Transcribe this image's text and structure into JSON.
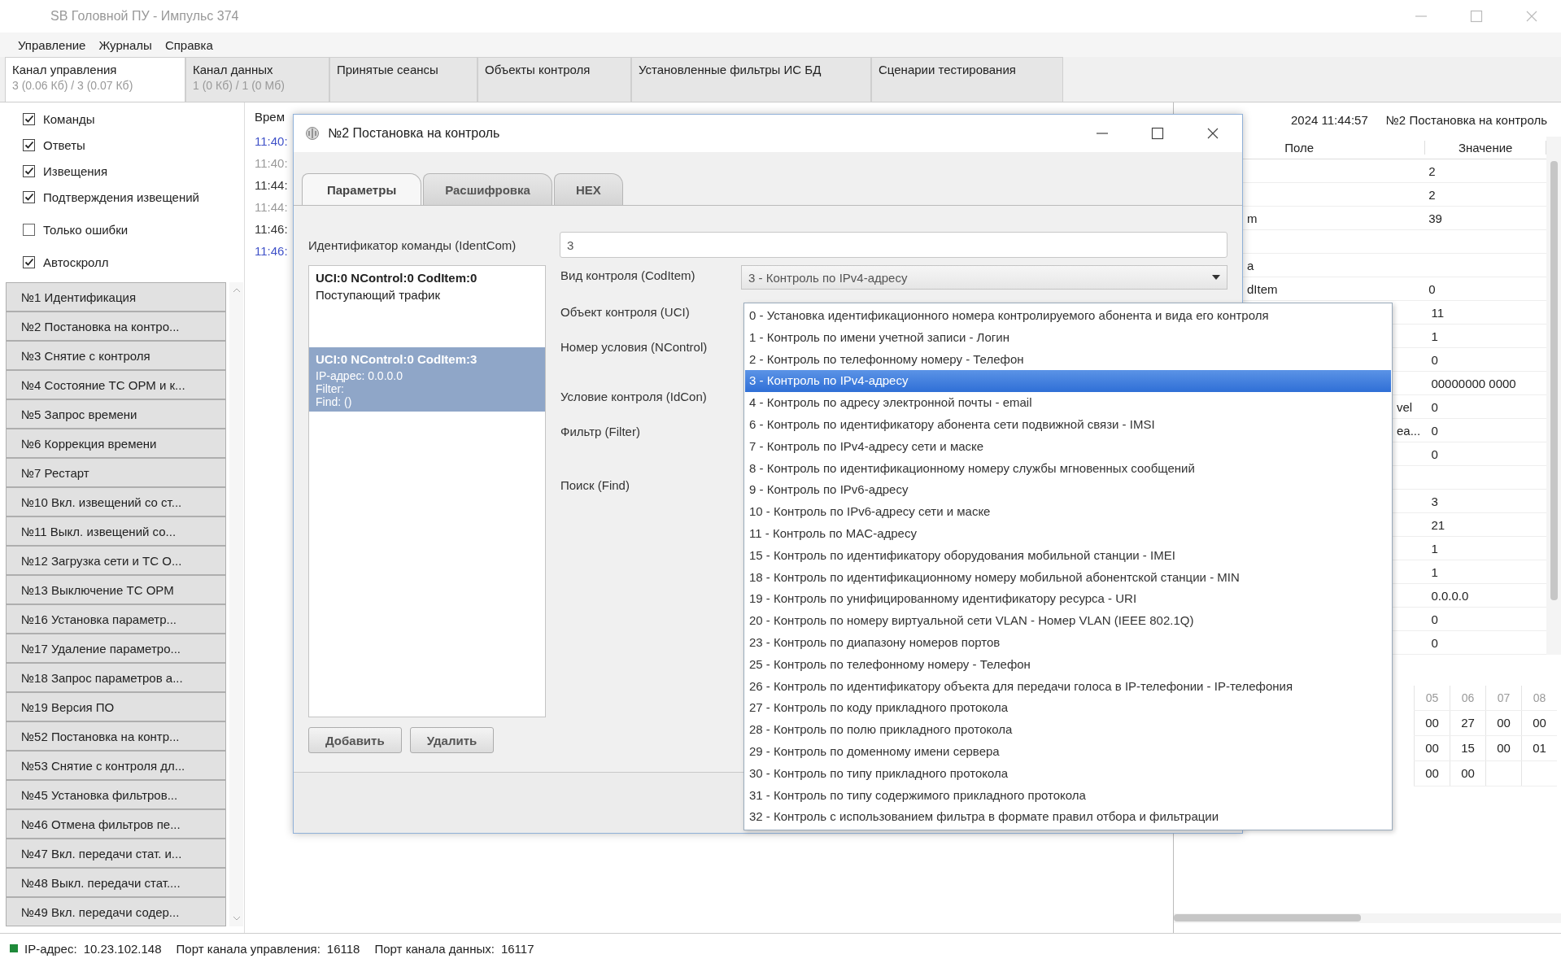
{
  "window": {
    "title": "SB Головной ПУ - Импульс 374"
  },
  "menu": [
    "Управление",
    "Журналы",
    "Справка"
  ],
  "tabs": [
    {
      "label": "Канал управления",
      "sub": "3 (0.06 Кб) / 3 (0.07 Кб)",
      "selected": true
    },
    {
      "label": "Канал данных",
      "sub": "1 (0 Кб) / 1 (0 Мб)",
      "selected": false
    },
    {
      "label": "Принятые сеансы",
      "selected": false
    },
    {
      "label": "Объекты контроля",
      "selected": false
    },
    {
      "label": "Установленные фильтры ИС БД",
      "selected": false
    },
    {
      "label": "Сценарии тестирования",
      "selected": false
    }
  ],
  "filters": [
    {
      "label": "Команды",
      "checked": true
    },
    {
      "label": "Ответы",
      "checked": true
    },
    {
      "label": "Извещения",
      "checked": true
    },
    {
      "label": "Подтверждения извещений",
      "checked": true
    },
    {
      "label": "Только ошибки",
      "checked": false
    },
    {
      "label": "Автоскролл",
      "checked": true
    }
  ],
  "log": {
    "header": "Врем",
    "times": [
      {
        "text": "11:40:",
        "color": "#3f51c8"
      },
      {
        "text": "11:40:",
        "color": "#9a9a9a"
      },
      {
        "text": "11:44:",
        "color": "#333333"
      },
      {
        "text": "11:44:",
        "color": "#9a9a9a"
      },
      {
        "text": "11:46:",
        "color": "#333333"
      },
      {
        "text": "11:46:",
        "color": "#3f51c8"
      }
    ]
  },
  "commands": [
    "№1 Идентификация",
    "№2 Постановка на контро...",
    "№3 Снятие с контроля",
    "№4 Состояние ТС ОРМ и к...",
    "№5 Запрос времени",
    "№6 Коррекция времени",
    "№7 Рестарт",
    "№10 Вкл. извещений со ст...",
    "№11 Выкл. извещений со...",
    "№12 Загрузка сети и ТС О...",
    "№13 Выключение ТС ОРМ",
    "№16 Установка параметр...",
    "№17 Удаление параметро...",
    "№18 Запрос параметров а...",
    "№19 Версия ПО",
    "№52 Постановка на контр...",
    "№53 Снятие с контроля дл...",
    "№45 Установка фильтров...",
    "№46 Отмена фильтров пе...",
    "№47 Вкл. передачи стат. и...",
    "№48 Выкл. передачи стат....",
    "№49 Вкл. передачи содер..."
  ],
  "details": {
    "timestamp": "2024 11:44:57",
    "title": "№2 Постановка на контроль",
    "columns": [
      "Поле",
      "Значение"
    ],
    "rows": [
      {
        "value": "2"
      },
      {
        "value": "2"
      },
      {
        "field": "m",
        "value": "39"
      },
      {},
      {
        "field": "a"
      },
      {
        "field": "dItem",
        "value": "0"
      },
      {
        "value": "11"
      },
      {
        "value": "1"
      },
      {
        "value": "0"
      },
      {
        "value": "00000000 0000"
      },
      {
        "field": "vel",
        "value": "0"
      },
      {
        "field": "ea...",
        "value": "0"
      },
      {
        "value": "0"
      },
      {},
      {
        "value": "3"
      },
      {
        "value": "21"
      },
      {
        "value": "1"
      },
      {
        "value": "1"
      },
      {
        "value": "0.0.0.0"
      },
      {
        "value": "0"
      },
      {
        "value": "0"
      }
    ]
  },
  "hex": {
    "columns": [
      "05",
      "06",
      "07",
      "08"
    ],
    "rows": [
      [
        "00",
        "27",
        "00",
        "00"
      ],
      [
        "00",
        "15",
        "00",
        "01"
      ],
      [
        "00",
        "00"
      ]
    ]
  },
  "status_bar": {
    "ip_label": "IP-адрес:",
    "ip": "10.23.102.148",
    "control_port_label": "Порт канала управления:",
    "control_port": "16118",
    "data_port_label": "Порт канала данных:",
    "data_port": "16117"
  },
  "dialog": {
    "title": "№2 Постановка на контроль",
    "tabs": [
      {
        "label": "Параметры",
        "selected": true
      },
      {
        "label": "Расшифровка",
        "selected": false
      },
      {
        "label": "HEX",
        "selected": false
      }
    ],
    "ident_label": "Идентификатор команды (IdentCom)",
    "ident_value": "3",
    "conditions": [
      {
        "header": "UCI:0  NControl:0  CodItem:0",
        "lines": [
          "Поступающий трафик"
        ],
        "selected": false
      },
      {
        "header": "UCI:0  NControl:0  CodItem:3",
        "lines": [
          "IP-адрес:  0.0.0.0",
          "Filter:",
          "Find:  ()"
        ],
        "selected": true
      }
    ],
    "buttons": [
      "Добавить",
      "Удалить"
    ],
    "fields": [
      "Вид контроля (CodItem)",
      "Объект контроля (UCI)",
      "Номер условия (NControl)",
      "Условие контроля (IdCon)",
      "Фильтр (Filter)",
      "Поиск (Find)"
    ],
    "combo_value": "3 - Контроль по IPv4-адресу",
    "options": [
      {
        "label": "0 - Установка идентификационного номера контролируемого абонента и вида его контроля",
        "selected": false
      },
      {
        "label": "1 - Контроль по имени учетной записи - Логин",
        "selected": false
      },
      {
        "label": "2 - Контроль по телефонному номеру - Телефон",
        "selected": false
      },
      {
        "label": "3 - Контроль по IPv4-адресу",
        "selected": true
      },
      {
        "label": "4 - Контроль по адресу электронной почты - email",
        "selected": false
      },
      {
        "label": "6 - Контроль по идентификатору абонента сети подвижной связи - IMSI",
        "selected": false
      },
      {
        "label": "7 - Контроль по IPv4-адресу сети и маске",
        "selected": false
      },
      {
        "label": "8 - Контроль по идентификационному номеру службы мгновенных сообщений",
        "selected": false
      },
      {
        "label": "9 - Контроль по IPv6-адресу",
        "selected": false
      },
      {
        "label": "10 - Контроль по IPv6-адресу сети и маске",
        "selected": false
      },
      {
        "label": "11 - Контроль по MAC-адресу",
        "selected": false
      },
      {
        "label": "15 - Контроль по идентификатору оборудования мобильной станции - IMEI",
        "selected": false
      },
      {
        "label": "18 - Контроль по идентификационному номеру мобильной абонентской станции - MIN",
        "selected": false
      },
      {
        "label": "19 - Контроль по унифицированному идентификатору ресурса - URI",
        "selected": false
      },
      {
        "label": "20 - Контроль по номеру виртуальной сети VLAN - Номер VLAN (IEEE 802.1Q)",
        "selected": false
      },
      {
        "label": "23 - Контроль по диапазону номеров портов",
        "selected": false
      },
      {
        "label": "25 - Контроль по телефонному номеру - Телефон",
        "selected": false
      },
      {
        "label": "26 - Контроль по идентификатору объекта для передачи голоса в IP-телефонии - IP-телефония",
        "selected": false
      },
      {
        "label": "27 - Контроль по коду прикладного протокола",
        "selected": false
      },
      {
        "label": "28 - Контроль по полю прикладного протокола",
        "selected": false
      },
      {
        "label": "29 - Контроль по доменному имени сервера",
        "selected": false
      },
      {
        "label": "30 - Контроль по типу прикладного протокола",
        "selected": false
      },
      {
        "label": "31 - Контроль по типу содержимого прикладного протокола",
        "selected": false
      },
      {
        "label": "32 - Контроль с использованием фильтра в формате правил отбора и фильтрации",
        "selected": false
      }
    ]
  }
}
